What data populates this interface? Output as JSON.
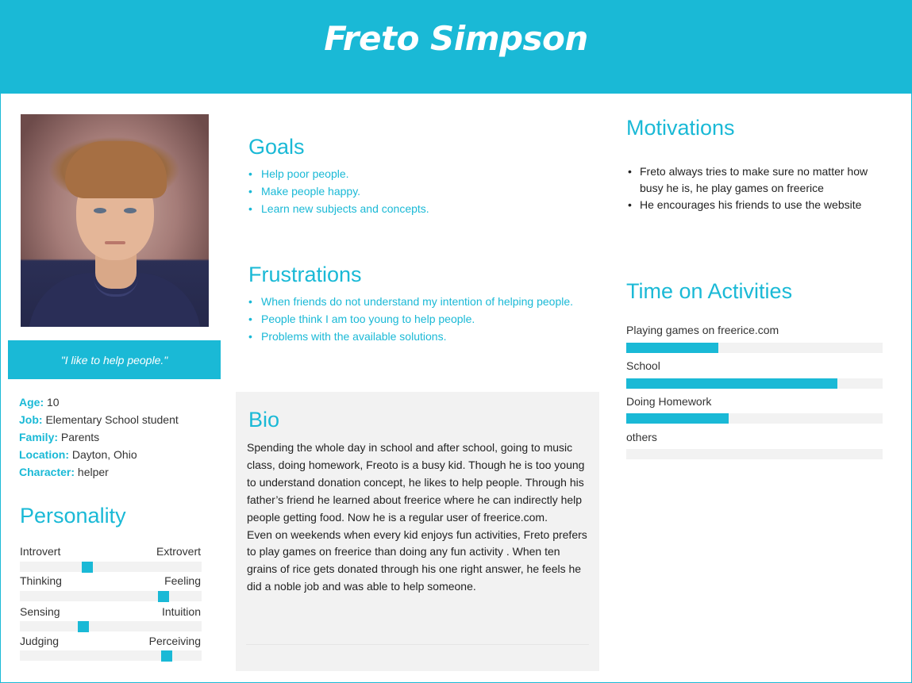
{
  "header": {
    "name": "Freto Simpson"
  },
  "quote": "\"I like to help people.\"",
  "facts": [
    {
      "label": "Age:",
      "value": "10"
    },
    {
      "label": "Job:",
      "value": "Elementary School student"
    },
    {
      "label": "Family:",
      "value": "Parents"
    },
    {
      "label": "Location:",
      "value": "Dayton, Ohio"
    },
    {
      "label": "Character:",
      "value": "helper"
    }
  ],
  "goals": {
    "title": "Goals",
    "items": [
      "Help poor people.",
      "Make people happy.",
      "Learn new subjects and concepts."
    ]
  },
  "frustrations": {
    "title": "Frustrations",
    "items": [
      "When friends do not understand my intention of helping people.",
      "People think I am too young to help people.",
      "Problems with the available solutions."
    ]
  },
  "bio": {
    "title": "Bio",
    "text": "Spending the whole day in school and after school, going to music class, doing homework, Freoto is a busy kid. Though he is too young to understand donation concept, he likes to help people. Through his father’s friend he learned about freerice where he can indirectly help people getting food. Now he is a regular user of freerice.com.\nEven on weekends when every kid enjoys fun activities, Freto prefers to play games on freerice than doing any fun activity . When ten grains of rice gets donated through his one right answer, he feels he did a noble job and was able to help someone."
  },
  "motivations": {
    "title": "Motivations",
    "items": [
      "Freto always tries to make sure no matter how busy he is, he play games on freerice",
      "He encourages his friends to use the website"
    ]
  },
  "activities": {
    "title": "Time on Activities",
    "items": [
      {
        "label": "Playing games on freerice.com",
        "fraction": 0.36
      },
      {
        "label": "School",
        "fraction": 0.825
      },
      {
        "label": "Doing Homework",
        "fraction": 0.4
      },
      {
        "label": "others",
        "fraction": 0.0
      }
    ]
  },
  "personality": {
    "title": "Personality",
    "traits": [
      {
        "left": "Introvert",
        "right": "Extrovert",
        "position": 0.37
      },
      {
        "left": "Thinking",
        "right": "Feeling",
        "position": 0.79
      },
      {
        "left": "Sensing",
        "right": "Intuition",
        "position": 0.35
      },
      {
        "left": "Judging",
        "right": "Perceiving",
        "position": 0.81
      }
    ]
  },
  "colors": {
    "accent": "#1ab9d6",
    "track": "#f2f2f2",
    "bio_bg": "#f2f2f2"
  }
}
